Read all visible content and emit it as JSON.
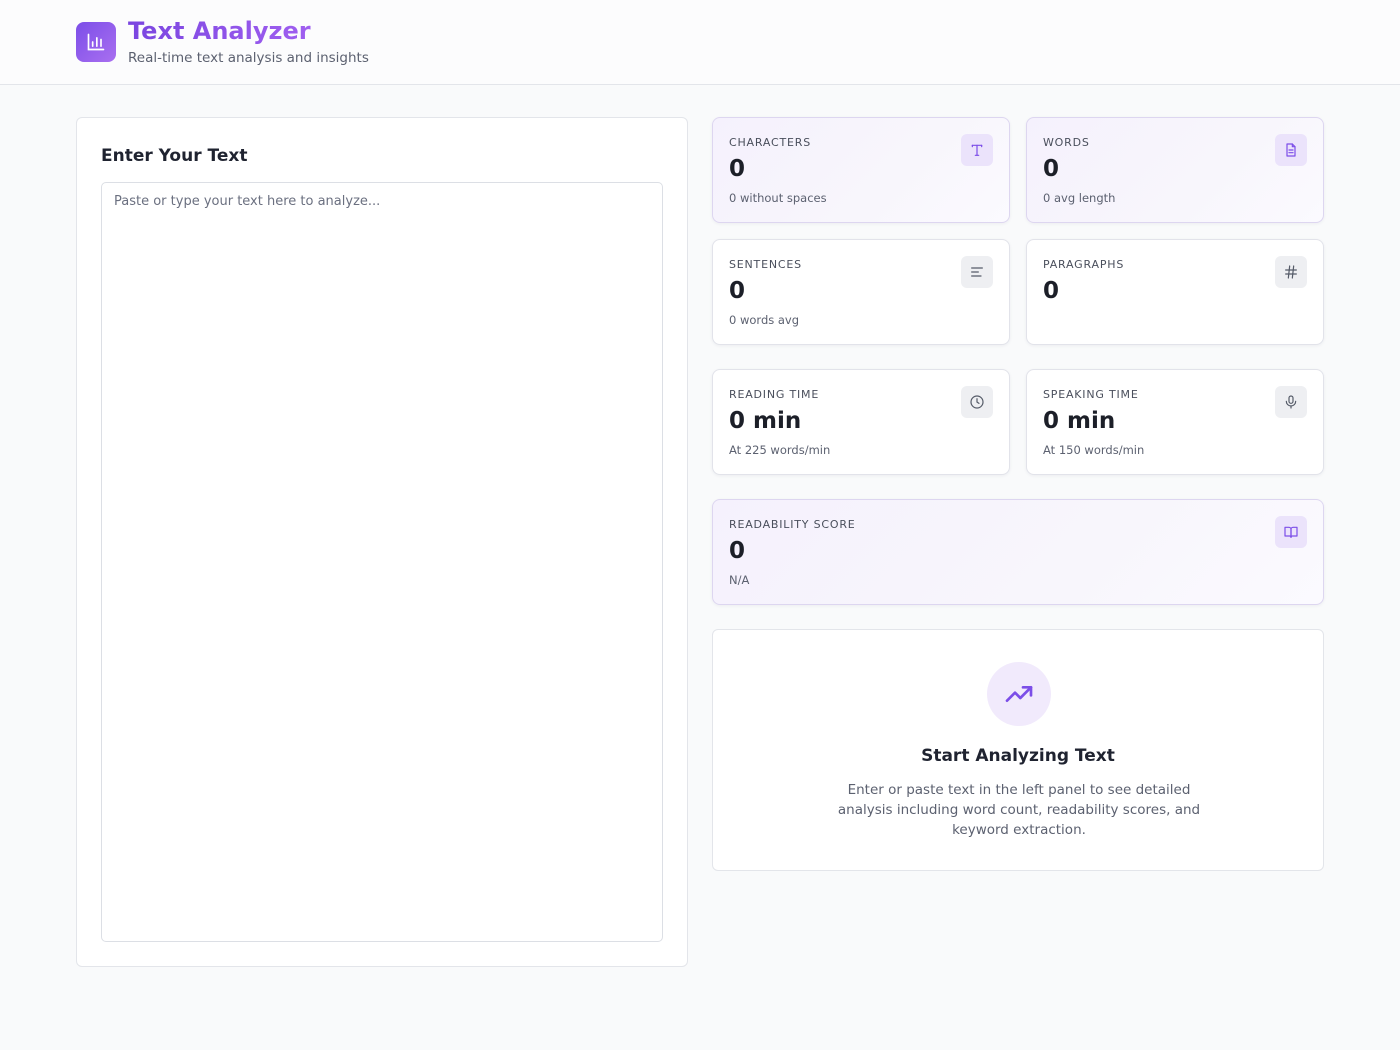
{
  "app": {
    "title": "Text Analyzer",
    "subtitle": "Real-time text analysis and insights",
    "logo_icon": "bar-chart-icon",
    "accent_color": "#7c4ee8"
  },
  "input": {
    "heading": "Enter Your Text",
    "value": "",
    "placeholder": "Paste or type your text here to analyze..."
  },
  "stats": {
    "characters": {
      "label": "CHARACTERS",
      "value": "0",
      "sub": "0 without spaces",
      "icon": "type-icon"
    },
    "words": {
      "label": "WORDS",
      "value": "0",
      "sub": "0 avg length",
      "icon": "document-icon"
    },
    "sentences": {
      "label": "SENTENCES",
      "value": "0",
      "sub": "0 words avg",
      "icon": "align-left-icon"
    },
    "paragraphs": {
      "label": "PARAGRAPHS",
      "value": "0",
      "icon": "hash-icon"
    },
    "reading_time": {
      "label": "READING TIME",
      "value": "0 min",
      "sub": "At 225 words/min",
      "icon": "clock-icon"
    },
    "speaking_time": {
      "label": "SPEAKING TIME",
      "value": "0 min",
      "sub": "At 150 words/min",
      "icon": "microphone-icon"
    },
    "readability": {
      "label": "READABILITY SCORE",
      "value": "0",
      "sub": "N/A",
      "icon": "book-open-icon"
    }
  },
  "empty_state": {
    "icon": "trending-up-icon",
    "title": "Start Analyzing Text",
    "description": "Enter or paste text in the left panel to see detailed analysis including word count, readability scores, and keyword extraction."
  }
}
